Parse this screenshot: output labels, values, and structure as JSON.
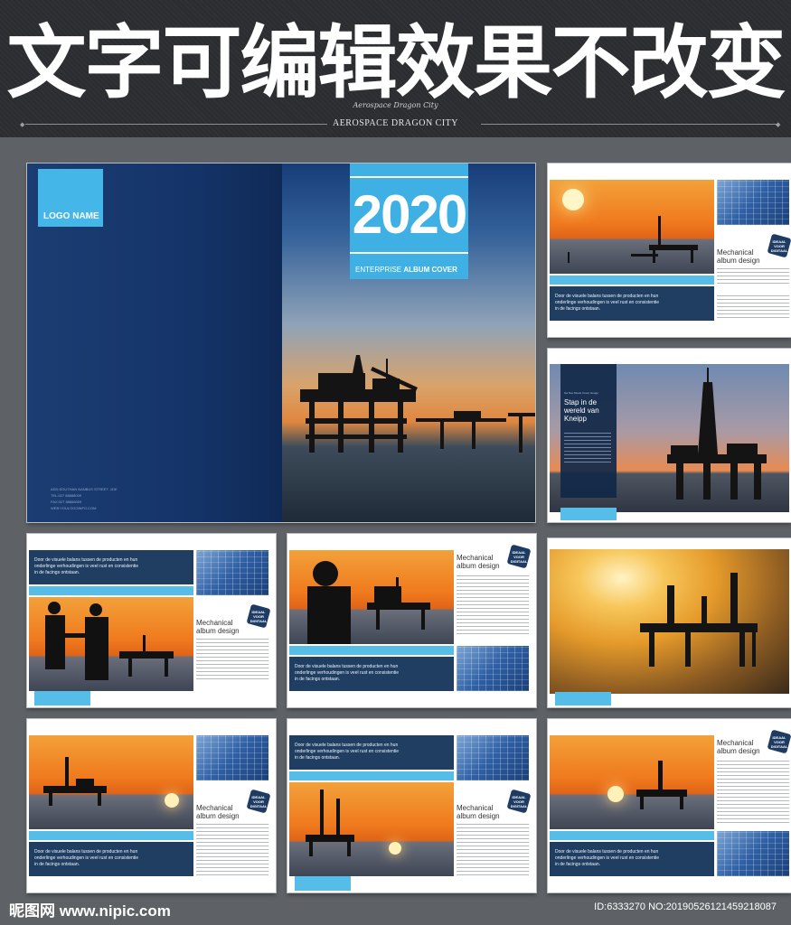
{
  "header": {
    "headline": "文字可编辑效果不改变",
    "script_line": "Aerospace Dragon City",
    "title_line": "AEROSPACE DRAGON CITY"
  },
  "cover": {
    "logo": "LOGO NAME",
    "year": "2020",
    "subtitle_light": "ENTERPRISE",
    "subtitle_bold": "ALBUM COVER",
    "contact": [
      "ADD:SOUTHAN NANBUS STREET .1DE",
      "TEL:027 88888009",
      "FAX:027 88888009",
      "WEB:YOULOGOINFO.COM"
    ]
  },
  "spread": {
    "kicker": "Mechanical",
    "title_line1": "Mechanical",
    "title_line2": "album design",
    "badge": "IDEAAL VOOR DIGITAAL",
    "body": "Door de visuele balans tussen de producten en hun onderlinge verhoudingen is veel rust en consistentie in de facings ontstaan.",
    "stap_kicker": "Ga Nou Mooie Cover Hooge",
    "stap": "Stap in de wereld van Kneipp"
  },
  "footer": {
    "brand": "昵图网 www.nipic.com",
    "id": "ID:6333270 NO:20190526121459218087"
  }
}
